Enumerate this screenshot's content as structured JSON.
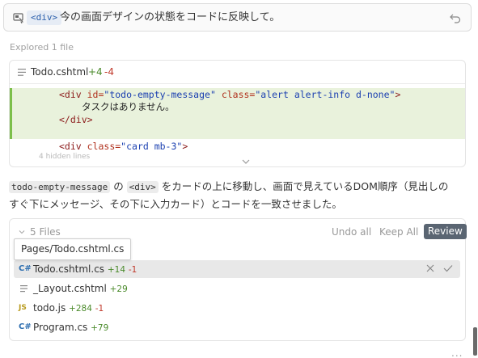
{
  "prompt": {
    "chip": "<div>",
    "text": "今の画面デザインの状態をコードに反映して。"
  },
  "explored": "Explored 1 file",
  "diff": {
    "file_name": "Todo.cshtml",
    "added": "+4",
    "removed": "-4",
    "cut_text": "4 hidden lines"
  },
  "code": {
    "l1_open": "<div ",
    "l1_attr1": "id=",
    "l1_val1": "\"todo-empty-message\"",
    "l1_attr2": " class=",
    "l1_val2": "\"alert alert-info d-none\"",
    "l1_close": ">",
    "l2_text": "タスクはありません。",
    "l3": "</div>",
    "l4_open": "<div ",
    "l4_attr": "class=",
    "l4_val": "\"card mb-3\"",
    "l4_close": ">"
  },
  "message": {
    "chip1": "todo-empty-message",
    "part1": " の ",
    "chip2": "<div>",
    "part2": " をカードの上に移動し、画面で見えているDOM順序（見出しの",
    "line2": "すぐ下にメッセージ、その下に入力カード）とコードを一致させました。"
  },
  "files": {
    "count_label": "5 Files",
    "undo_all": "Undo all",
    "keep_all": "Keep All",
    "review": "Review",
    "tooltip": "Pages/Todo.cshtml.cs",
    "items": [
      {
        "name": "Todo.cshtml.cs",
        "add": "+14",
        "del": "-1",
        "icon": "csharp-icon"
      },
      {
        "name": "_Layout.cshtml",
        "add": "+29",
        "del": "",
        "icon": "file-lines-icon"
      },
      {
        "name": "todo.js",
        "add": "+284",
        "del": "-1",
        "icon": "js-icon"
      },
      {
        "name": "Program.cs",
        "add": "+79",
        "del": "",
        "icon": "csharp-icon"
      }
    ]
  },
  "more": "...",
  "colors": {
    "add": "#4a8a2a",
    "del": "#c0392b",
    "diff_bg": "#e9f2dc",
    "accent_bar": "#7cbf4a",
    "review_bg": "#5a6572"
  }
}
